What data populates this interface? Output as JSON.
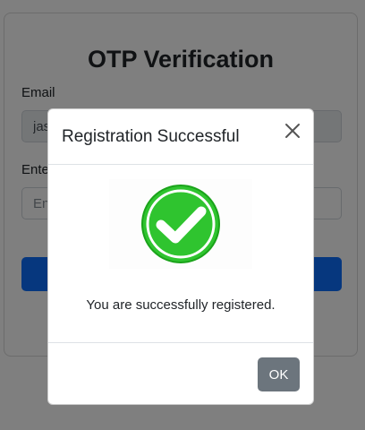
{
  "form": {
    "title": "OTP Verification",
    "email_label": "Email",
    "email_value": "jas",
    "otp_label": "Ente",
    "otp_placeholder": "En"
  },
  "modal": {
    "title": "Registration Successful",
    "close_icon": "close-icon",
    "success_icon": "check-circle-icon",
    "message": "You are successfully registered.",
    "ok_label": "OK"
  },
  "colors": {
    "primary": "#0d6efd",
    "secondary": "#6c757d",
    "success": "#2ecc2e",
    "backdrop": "rgba(0,0,0,0.5)"
  }
}
